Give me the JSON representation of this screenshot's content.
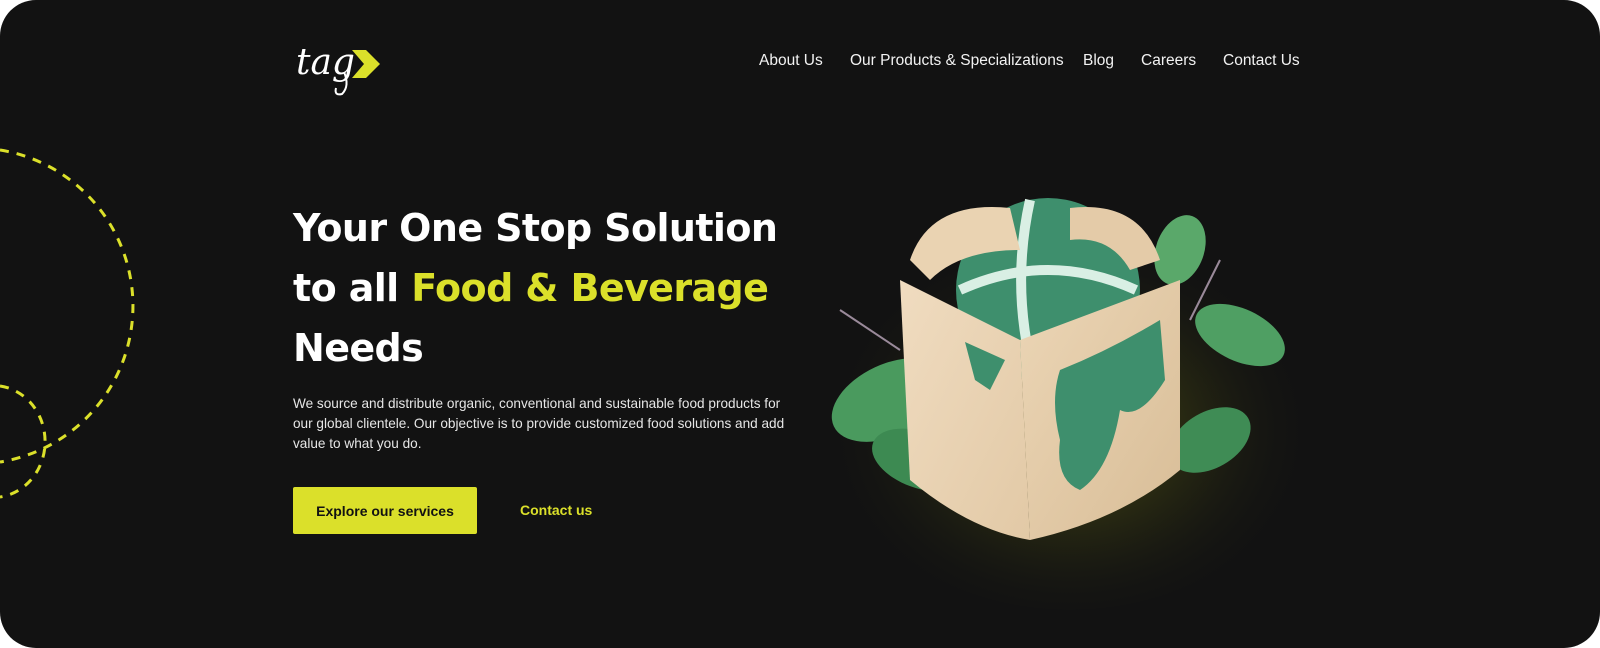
{
  "brand": {
    "logo_text": "tag",
    "accent_color": "#dbe02a",
    "background_color": "#121212"
  },
  "nav": {
    "items": [
      {
        "label": "About Us"
      },
      {
        "label": "Our Products & Specializations"
      },
      {
        "label": "Blog"
      },
      {
        "label": "Careers"
      },
      {
        "label": "Contact Us"
      }
    ]
  },
  "hero": {
    "headline_line1": "Your One Stop Solution",
    "headline_prefix": "to all ",
    "headline_highlight": "Food & Beverage",
    "headline_line3": "Needs",
    "description": "We source and distribute organic, conventional and sustainable food products for our global clientele. Our objective is to provide customized food solutions and add value to what you do.",
    "primary_cta": "Explore our services",
    "secondary_cta": "Contact us",
    "illustration_icon": "globe-in-box-with-leaves"
  }
}
